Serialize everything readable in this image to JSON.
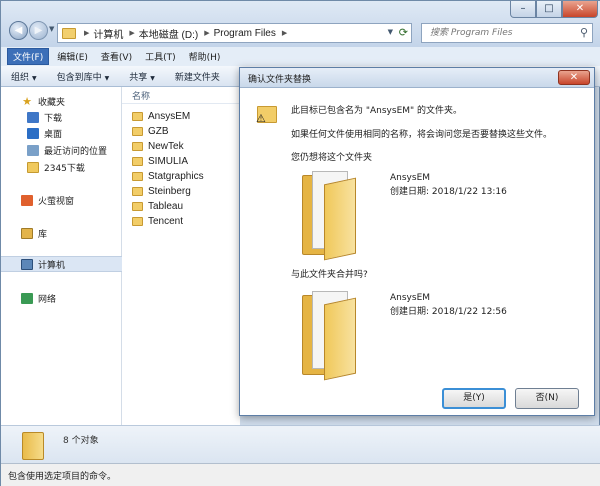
{
  "address": {
    "crumbs": [
      "计算机",
      "本地磁盘 (D:)",
      "Program Files"
    ]
  },
  "search": {
    "placeholder": "搜索 Program Files"
  },
  "menu": [
    "文件(F)",
    "编辑(E)",
    "查看(V)",
    "工具(T)",
    "帮助(H)"
  ],
  "toolbar": [
    "组织",
    "包含到库中",
    "共享",
    "新建文件夹"
  ],
  "sidebar": {
    "favorites": "收藏夹",
    "favorite_items": [
      "下载",
      "桌面",
      "最近访问的位置",
      "2345下载"
    ],
    "huoban": "火萤视窗",
    "library": "库",
    "computer": "计算机",
    "network": "网络"
  },
  "filelist": {
    "column": "名称",
    "items": [
      "AnsysEM",
      "GZB",
      "NewTek",
      "SIMULIA",
      "Statgraphics",
      "Steinberg",
      "Tableau",
      "Tencent"
    ]
  },
  "details": {
    "count": "8 个对象"
  },
  "status": {
    "text": "包含使用选定项目的命令。"
  },
  "dialog": {
    "title": "确认文件夹替换",
    "line1": "此目标已包含名为 \"AnsysEM\" 的文件夹。",
    "line2": "如果任何文件使用相同的名称，将会询问您是否要替换这些文件。",
    "line3": "您仍想将这个文件夹",
    "line4": "与此文件夹合并吗?",
    "folder1": {
      "name": "AnsysEM",
      "date": "创建日期: 2018/1/22 13:16"
    },
    "folder2": {
      "name": "AnsysEM",
      "date": "创建日期: 2018/1/22 12:56"
    },
    "yes": "是(Y)",
    "no": "否(N)"
  }
}
